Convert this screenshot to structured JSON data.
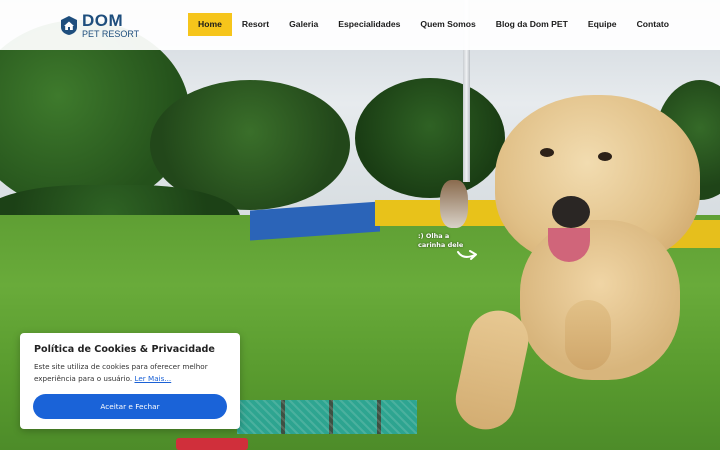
{
  "brand": {
    "name": "DOM",
    "tagline": "PET RESORT"
  },
  "nav": {
    "items": [
      {
        "label": "Home",
        "active": true
      },
      {
        "label": "Resort"
      },
      {
        "label": "Galeria"
      },
      {
        "label": "Especialidades"
      },
      {
        "label": "Quem Somos"
      },
      {
        "label": "Blog da Dom PET"
      },
      {
        "label": "Equipe"
      },
      {
        "label": "Contato"
      }
    ]
  },
  "hero": {
    "annotation_line1": ":) Olha a",
    "annotation_line2": "carinha dele"
  },
  "cookie": {
    "title": "Política de Cookies & Privacidade",
    "text": "Este site utiliza de cookies para oferecer melhor experiência para o usuário.",
    "link": "Ler Mais...",
    "button": "Aceitar e Fechar"
  },
  "colors": {
    "nav_active": "#f6c51b",
    "brand": "#1e4e7d",
    "button": "#1a63d8",
    "link": "#1a61d6"
  },
  "icons": {
    "logo": "house-shield-icon",
    "annotation": "curved-arrow-icon"
  }
}
